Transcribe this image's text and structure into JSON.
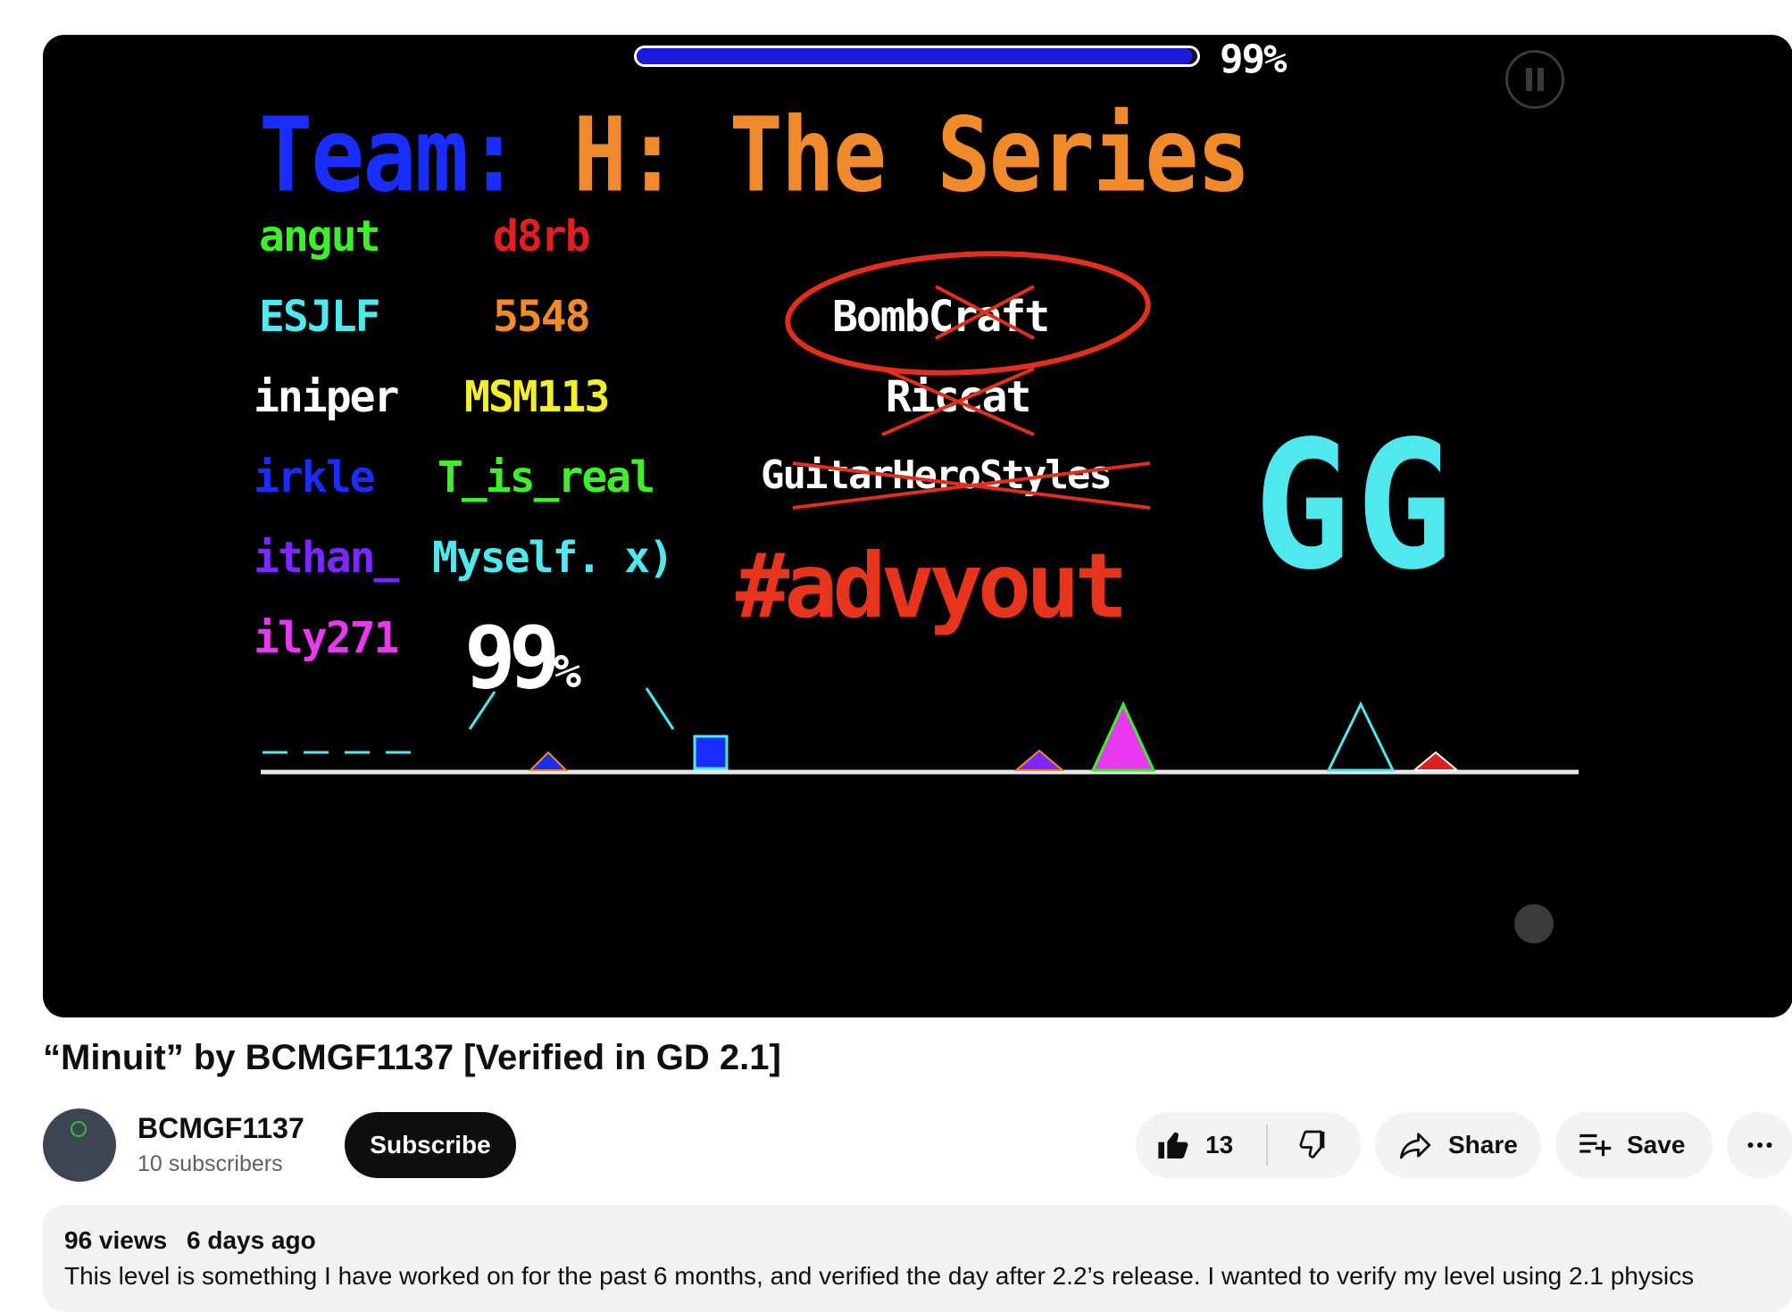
{
  "video": {
    "progress_label": "99%",
    "progress_fraction": 0.99,
    "credits": {
      "team_word": "Team:",
      "series_title": "H: The Series",
      "column1": [
        {
          "text": "angut",
          "color": "#3ef02a"
        },
        {
          "text": "ESJLF",
          "color": "#4fe8ee"
        },
        {
          "text": "iniper",
          "color": "#ffffff"
        },
        {
          "text": "irkle",
          "color": "#1a2dff"
        },
        {
          "text": "ithan_",
          "color": "#7a28ff"
        },
        {
          "text": "ily271",
          "color": "#e838f0"
        }
      ],
      "column2": [
        {
          "text": "d8rb",
          "color": "#e02020"
        },
        {
          "text": "5548",
          "color": "#f08a2a"
        },
        {
          "text": "MSM113",
          "color": "#f2ee2a"
        },
        {
          "text": "T_is_real",
          "color": "#3ef02a"
        },
        {
          "text": "Myself. x)",
          "color": "#4fe8ee"
        }
      ],
      "column3": [
        "BombCraft",
        "Riccat",
        "GuitarHeroStyles"
      ],
      "hashtag": "#advyout",
      "gg": "GG",
      "big_percent": "99",
      "big_percent_suffix": "%"
    },
    "colors": {
      "progress_fill": "#1a1ae0",
      "annotation_red": "#e0301c"
    }
  },
  "title": "“Minuit” by BCMGF1137 [Verified in GD 2.1]",
  "channel": {
    "name": "BCMGF1137",
    "subscribers": "10 subscribers",
    "subscribe_label": "Subscribe"
  },
  "actions": {
    "like_count": "13",
    "share_label": "Share",
    "save_label": "Save",
    "icons": [
      "thumbs-up-icon",
      "thumbs-down-icon",
      "share-arrow-icon",
      "playlist-add-icon",
      "more-icon"
    ]
  },
  "description": {
    "views": "96 views",
    "date": "6 days ago",
    "text": "This level is something I have worked on for the past 6 months, and verified the day after 2.2’s release. I wanted to verify my level using 2.1 physics"
  }
}
